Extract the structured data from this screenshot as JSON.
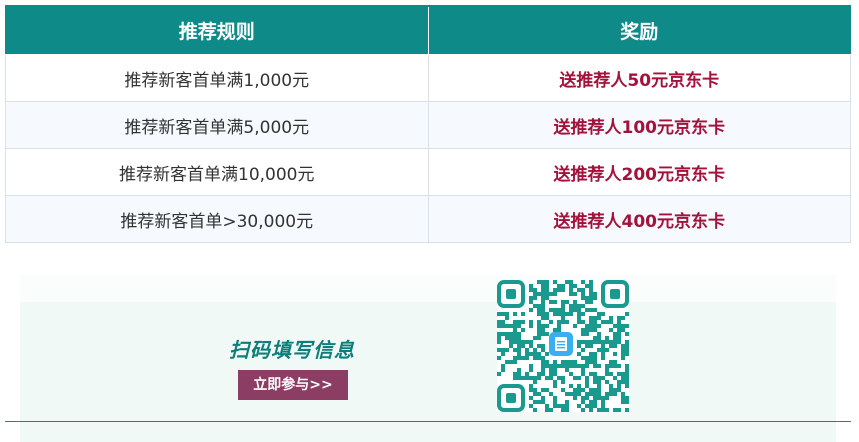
{
  "table": {
    "headers": [
      "推荐规则",
      "奖励"
    ],
    "rows": [
      {
        "rule": "推荐新客首单满1,000元",
        "reward": "送推荐人50元京东卡"
      },
      {
        "rule": "推荐新客首单满5,000元",
        "reward": "送推荐人100元京东卡"
      },
      {
        "rule": "推荐新客首单满10,000元",
        "reward": "送推荐人200元京东卡"
      },
      {
        "rule": "推荐新客首单>30,000元",
        "reward": "送推荐人400元京东卡"
      }
    ]
  },
  "promo": {
    "scan_text": "扫码填写信息",
    "join_label": "立即参与>>",
    "qr_icon": "qr-code-icon",
    "center_icon": "form-icon"
  },
  "colors": {
    "header_bg": "#0e8b88",
    "reward_text": "#a3123b",
    "button_bg": "#8c3d64",
    "scan_text": "#0e7e7a",
    "qr_color": "#1a9a8e",
    "qr_center": "#3aaef0"
  }
}
